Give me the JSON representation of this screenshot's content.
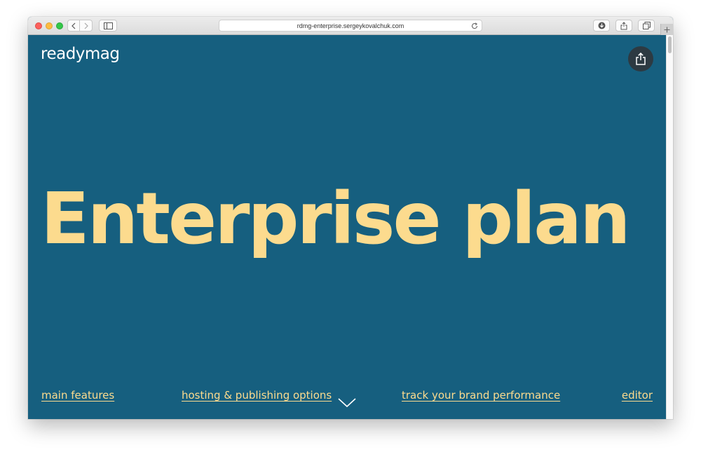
{
  "browser": {
    "url": "rdmg-enterprise.sergeykovalchuk.com",
    "icons": [
      "back-icon",
      "forward-icon",
      "sidebar-icon",
      "reload-icon",
      "download-icon",
      "share-icon",
      "tabs-icon",
      "plus-icon"
    ]
  },
  "site": {
    "logo": "readymag",
    "headline": "Enterprise plan",
    "nav": {
      "features": "main features",
      "hosting": "hosting & publishing options",
      "track": "track your brand performance",
      "editor": "editor"
    }
  },
  "colors": {
    "background": "#165f7f",
    "accent": "#fcdb8e",
    "share_button": "#2d3a42"
  }
}
